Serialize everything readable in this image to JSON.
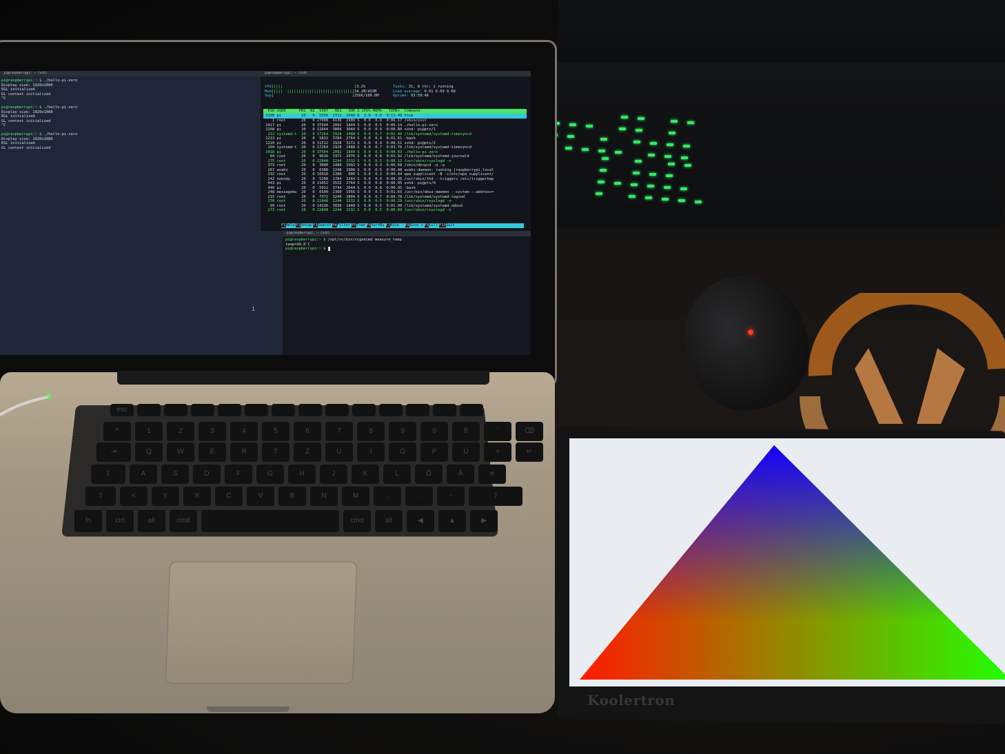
{
  "left_terminal": {
    "tab_title": "pi@raspberrypi: ~ (ssh)",
    "lines": [
      {
        "prompt": "pi@raspberrypi:~ $ ",
        "cmd": "./hello-pi-zero"
      },
      {
        "text": "Display size: 1920x1080"
      },
      {
        "text": "EGL initialized"
      },
      {
        "text": "GL context initialized"
      },
      {
        "text": "^C"
      },
      {
        "prompt": "pi@raspberrypi:~ $ ",
        "cmd": "./hello-pi-zero"
      },
      {
        "text": "Display size: 1920x1080"
      },
      {
        "text": "EGL initialized"
      },
      {
        "text": "GL context initialized"
      },
      {
        "text": "^C"
      },
      {
        "prompt": "pi@raspberrypi:~ $ ",
        "cmd": "./hello-pi-zero"
      },
      {
        "text": "Display size: 1920x1080"
      },
      {
        "text": "EGL initialized"
      },
      {
        "text": "GL context initialized"
      }
    ],
    "pane_number": "1"
  },
  "htop": {
    "tab_title": "pi@raspberrypi: ~ (ssh)",
    "cpu_label": "CPU",
    "cpu_value": "3.2%",
    "mem_label": "Mem",
    "mem_value": "34.1M/433M",
    "swp_label": "Swp",
    "swp_value": "256K/100.0M",
    "tasks_label": "Tasks:",
    "tasks_value": "31, 8 thr; 1 running",
    "load_label": "Load average:",
    "load_value": "0.01 0.09 0.08",
    "uptime_label": "Uptime:",
    "uptime_value": "03:59:46",
    "header": "  PID USER      PRI  NI  VIRT   RES   SHR S CPU% MEM%   TIME+  Command",
    "selected_row": " 1198 pi         20   0  5556  2712  2048 R  2.6  0.6  0:11.48 htop",
    "rows": [
      "    1 root       20   0 27008  4136  2900 S  0.0  0.9  0:06.17 /sbin/init",
      " 1417 pi         20   0 37504  2092  1844 S  0.0  0.5  0:00.14 ./hello-pi-zero",
      " 1168 pi         20   0 11644  3804  3044 S  0.0  0.9  0:00.80 sshd: pi@pts/1",
      "  212 systemd-t  20   0 17264  2928  2488 S  0.0  0.7  0:02.49 /lib/systemd/systemd-timesyncd",
      " 1213 pi         20   0  5832  3784  2764 S  0.0  0.9  0:01.61 -bash",
      " 1210 pi         20   0 11512  3928  3172 S  0.0  0.9  0:00.51 sshd: pi@pts/2",
      "  194 systemd-t  20   0 17264  2928  2488 S  0.0  0.7  0:03.76 /lib/systemd/systemd-timesyncd",
      " 1418 pi         20   0 37504  2092  1844 S  0.0  0.5  0:00.03 ./hello-pi-zero",
      "   84 root       20   0  9616  3372  2976 S  0.0  0.8  0:01.92 /lib/systemd/systemd-journald",
      "  275 root       20   0 22848  2244  1532 S  0.0  0.5  0:00.12 /usr/sbin/rsyslogd -n",
      "  379 root       20   0  3000  1488  1092 S  0.0  0.3  0:00.68 /sbin/dhcpcd -q -w",
      "  267 avahi      20   0  6388  2248  1908 S  0.0  0.5  0:00.48 avahi-daemon: running [raspberrypi.local",
      "  332 root       20   0 10016  1380   800 S  0.0  0.3  0:00.44 wpa_supplicant -B -c/etc/wpa_supplicant/",
      "  242 nobody     20   0  5208  1784  1544 S  0.0  0.4  0:00.36 /usr/sbin/thd --triggers /etc/triggerhap",
      "  443 pi         20   0 11652  3532  2764 S  0.0  0.8  0:00.95 sshd: pi@pts/0",
      "  446 pi         20   0  5912  3744  2644 S  0.0  0.8  0:00.95 -bash",
      "  248 messagebu  20   0  6500  2360  1956 S  0.0  0.5  0:01.65 /usr/bin/dbus-daemon --system --address=",
      "  215 root       20   0  7372  3240  2804 S  0.0  0.7  0:00.78 /lib/systemd/systemd-logind",
      "  270 root       20   0 22848  2244  1532 S  0.0  0.5  0:00.29 /usr/sbin/rsyslogd -n",
      "   99 root       20   0 14336  3036  1440 S  0.0  0.5  0:01.08 /lib/systemd/systemd-udevd",
      "  273 root       20   0 22848  2244  1532 S  0.0  0.5  0:00.09 /usr/sbin/rsyslogd -n"
    ],
    "fkeys": [
      {
        "k": "F1",
        "l": "Help"
      },
      {
        "k": "F2",
        "l": "Setup"
      },
      {
        "k": "F3",
        "l": "Search"
      },
      {
        "k": "F4",
        "l": "Filter"
      },
      {
        "k": "F5",
        "l": "Tree"
      },
      {
        "k": "F6",
        "l": "SortBy"
      },
      {
        "k": "F7",
        "l": "Nice -"
      },
      {
        "k": "F8",
        "l": "Nice +"
      },
      {
        "k": "F9",
        "l": "Kill"
      },
      {
        "k": "F10",
        "l": "Quit"
      }
    ]
  },
  "bottom_terminal": {
    "tab_title": "pi@raspberrypi: ~ (ssh)",
    "prompt": "pi@raspberrypi:~ $ ",
    "cmd": "/opt/vc/bin/vcgencmd measure_temp",
    "output": "temp=49.8'C",
    "prompt2": "pi@raspberrypi:~ $ "
  },
  "keyboard_rows": [
    [
      "esc",
      "",
      "",
      "",
      "",
      "",
      "",
      "",
      "",
      "",
      "",
      "",
      "",
      ""
    ],
    [
      "^",
      "1",
      "2",
      "3",
      "4",
      "5",
      "6",
      "7",
      "8",
      "9",
      "0",
      "ß",
      "´",
      "⌫"
    ],
    [
      "⇥",
      "Q",
      "W",
      "E",
      "R",
      "T",
      "Z",
      "U",
      "I",
      "O",
      "P",
      "Ü",
      "+",
      "↵"
    ],
    [
      "⇪",
      "A",
      "S",
      "D",
      "F",
      "G",
      "H",
      "J",
      "K",
      "L",
      "Ö",
      "Ä",
      "#"
    ],
    [
      "⇧",
      "<",
      "Y",
      "X",
      "C",
      "V",
      "B",
      "N",
      "M",
      ",",
      ".",
      "-",
      "⇧"
    ],
    [
      "fn",
      "ctrl",
      "alt",
      "cmd",
      "",
      "cmd",
      "alt",
      "◀",
      "▲",
      "▶"
    ]
  ],
  "monitor": {
    "brand": "Koolertron",
    "triangle_colors": {
      "top": "#1400ff",
      "left": "#ff1a00",
      "right": "#22ff00"
    },
    "background": "#e9edf1"
  },
  "colors": {
    "terminal_bg": "#1f2637",
    "htop_accent": "#36c8da",
    "prompt_green": "#5ef56a",
    "keyboard_glow": "#38e86a"
  }
}
